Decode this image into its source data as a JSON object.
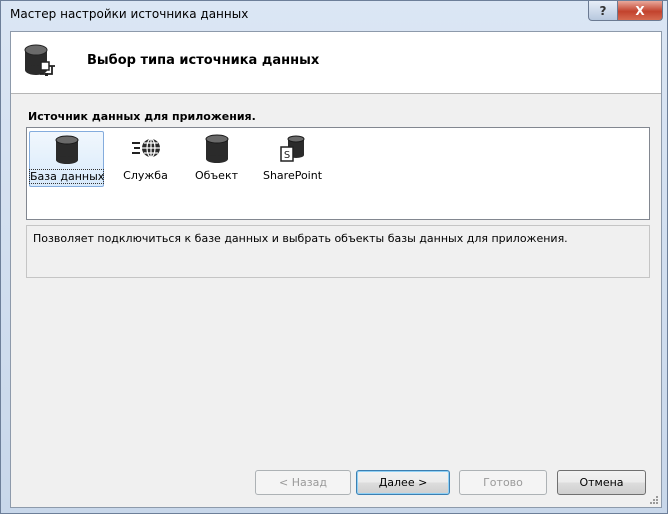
{
  "window": {
    "title": "Мастер настройки источника данных",
    "help_label": "?",
    "close_label": "X"
  },
  "header": {
    "title": "Выбор типа источника данных",
    "icon": "database-plug-icon"
  },
  "section": {
    "label": "Источник данных для приложения."
  },
  "types": [
    {
      "label": "База данных",
      "icon": "database-icon",
      "selected": true
    },
    {
      "label": "Служба",
      "icon": "globe-service-icon",
      "selected": false
    },
    {
      "label": "Объект",
      "icon": "object-cylinder-icon",
      "selected": false
    },
    {
      "label": "SharePoint",
      "icon": "sharepoint-icon",
      "selected": false
    }
  ],
  "description": "Позволяет подключиться к базе данных и выбрать объекты базы данных для приложения.",
  "buttons": {
    "back": "< Назад",
    "next": "Далее >",
    "finish": "Готово",
    "cancel": "Отмена"
  },
  "colors": {
    "client_bg": "#f0f0f0",
    "header_bg": "#ffffff",
    "selection_border": "#84acdd",
    "close_red": "#c2422d"
  }
}
